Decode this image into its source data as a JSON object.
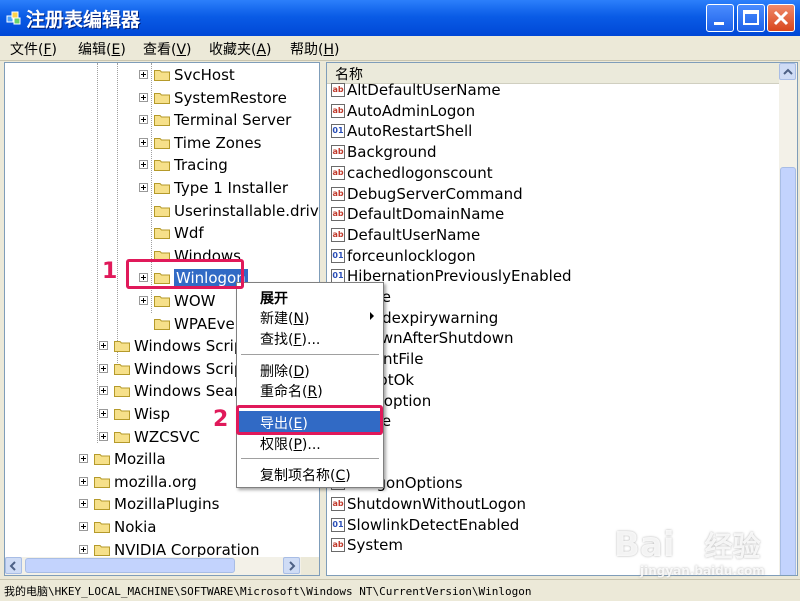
{
  "window": {
    "title": "注册表编辑器"
  },
  "menubar": {
    "items": [
      {
        "label": "文件",
        "key": "F"
      },
      {
        "label": "编辑",
        "key": "E"
      },
      {
        "label": "查看",
        "key": "V"
      },
      {
        "label": "收藏夹",
        "key": "A"
      },
      {
        "label": "帮助",
        "key": "H"
      }
    ]
  },
  "tree": {
    "nodes": [
      {
        "label": "SvcHost",
        "expand": true
      },
      {
        "label": "SystemRestore",
        "expand": true
      },
      {
        "label": "Terminal Server",
        "expand": true
      },
      {
        "label": "Time Zones",
        "expand": true
      },
      {
        "label": "Tracing",
        "expand": true
      },
      {
        "label": "Type 1 Installer",
        "expand": true
      },
      {
        "label": "Userinstallable.driv",
        "expand": false
      },
      {
        "label": "Wdf",
        "expand": false
      },
      {
        "label": "Windows",
        "expand": false
      },
      {
        "label": "Winlogon",
        "expand": true,
        "selected": true
      },
      {
        "label": "WOW",
        "expand": true
      },
      {
        "label": "WPAEver",
        "expand": false
      },
      {
        "label": "Windows Script",
        "expand": true
      },
      {
        "label": "Windows Script",
        "expand": true
      },
      {
        "label": "Windows Searc",
        "expand": true
      },
      {
        "label": "Wisp",
        "expand": true
      },
      {
        "label": "WZCSVC",
        "expand": true
      },
      {
        "label": "Mozilla",
        "expand": true
      },
      {
        "label": "mozilla.org",
        "expand": true
      },
      {
        "label": "MozillaPlugins",
        "expand": true
      },
      {
        "label": "Nokia",
        "expand": true
      },
      {
        "label": "NVIDIA Corporation",
        "expand": true
      }
    ]
  },
  "list": {
    "header": "名称",
    "rows": [
      {
        "label": "AltDefaultUserName",
        "icon": "string-value-icon"
      },
      {
        "label": "AutoAdminLogon",
        "icon": "string-value-icon"
      },
      {
        "label": "AutoRestartShell",
        "icon": "binary-value-icon"
      },
      {
        "label": "Background",
        "icon": "string-value-icon"
      },
      {
        "label": "cachedlogonscount",
        "icon": "string-value-icon"
      },
      {
        "label": "DebugServerCommand",
        "icon": "string-value-icon"
      },
      {
        "label": "DefaultDomainName",
        "icon": "string-value-icon"
      },
      {
        "label": "DefaultUserName",
        "icon": "string-value-icon"
      },
      {
        "label": "forceunlocklogon",
        "icon": "binary-value-icon"
      },
      {
        "label": "HibernationPreviouslyEnabled",
        "icon": "binary-value-icon"
      },
      {
        "label": "nType",
        "icon": "string-value-icon"
      },
      {
        "label": "swordexpirywarning",
        "icon": "binary-value-icon"
      },
      {
        "label": "erdownAfterShutdown",
        "icon": "string-value-icon"
      },
      {
        "label": "adFontFile",
        "icon": "string-value-icon"
      },
      {
        "label": "rtBootOk",
        "icon": "string-value-icon"
      },
      {
        "label": "noveoption",
        "icon": "string-value-icon"
      },
      {
        "label": "isable",
        "icon": "string-value-icon"
      },
      {
        "label": "uota",
        "icon": "string-value-icon"
      },
      {
        "label": "",
        "icon": "string-value-icon"
      },
      {
        "label": "wLogonOptions",
        "icon": "string-value-icon"
      },
      {
        "label": "ShutdownWithoutLogon",
        "icon": "string-value-icon"
      },
      {
        "label": "SlowlinkDetectEnabled",
        "icon": "binary-value-icon"
      },
      {
        "label": "System",
        "icon": "string-value-icon"
      }
    ]
  },
  "context_menu": {
    "items": [
      {
        "label": "展开",
        "bold": true
      },
      {
        "label": "新建",
        "key": "N",
        "submenu": true
      },
      {
        "label": "查找",
        "key": "F",
        "ellipsis": "..."
      },
      {
        "sep": true
      },
      {
        "label": "删除",
        "key": "D"
      },
      {
        "label": "重命名",
        "key": "R"
      },
      {
        "sep": true
      },
      {
        "label": "导出",
        "key": "E",
        "highlight": true
      },
      {
        "label": "权限",
        "key": "P",
        "ellipsis": "..."
      },
      {
        "sep": true
      },
      {
        "label": "复制项名称",
        "key": "C"
      }
    ]
  },
  "annotations": {
    "step1": "1",
    "step2": "2"
  },
  "status": {
    "path": "我的电脑\\HKEY_LOCAL_MACHINE\\SOFTWARE\\Microsoft\\Windows NT\\CurrentVersion\\Winlogon"
  },
  "watermark": {
    "brand": "Bai",
    "tail": "经验",
    "url": "jingyan.baidu.com"
  },
  "colors": {
    "titlebar": "#0a5ce6",
    "selection": "#316ac5",
    "annotation": "#e0195a"
  }
}
